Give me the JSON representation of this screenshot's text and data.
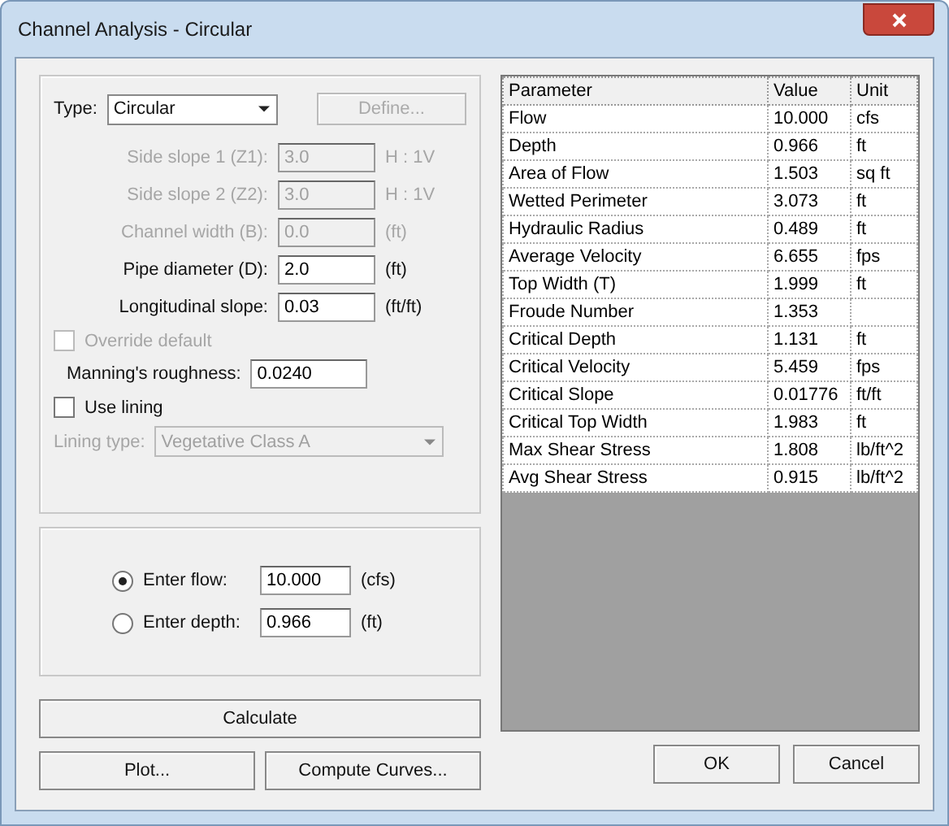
{
  "window": {
    "title": "Channel Analysis - Circular"
  },
  "type_select": {
    "label": "Type:",
    "value": "Circular",
    "disabled": false
  },
  "define_button": {
    "label": "Define...",
    "disabled": true
  },
  "fields": [
    {
      "label": "Side slope 1 (Z1):",
      "value": "3.0",
      "unit": "H : 1V",
      "disabled": true
    },
    {
      "label": "Side slope 2 (Z2):",
      "value": "3.0",
      "unit": "H : 1V",
      "disabled": true
    },
    {
      "label": "Channel width (B):",
      "value": "0.0",
      "unit": "(ft)",
      "disabled": true
    },
    {
      "label": "Pipe diameter (D):",
      "value": "2.0",
      "unit": "(ft)",
      "disabled": false
    },
    {
      "label": "Longitudinal slope:",
      "value": "0.03",
      "unit": "(ft/ft)",
      "disabled": false
    }
  ],
  "override_default": {
    "label": "Override default",
    "checked": false,
    "disabled": true
  },
  "mannings": {
    "label": "Manning's roughness:",
    "value": "0.0240"
  },
  "use_lining": {
    "label": "Use lining",
    "checked": false,
    "disabled": false
  },
  "lining_type": {
    "label": "Lining type:",
    "value": "Vegetative Class A",
    "disabled": true
  },
  "entry": [
    {
      "label": "Enter flow:",
      "value": "10.000",
      "unit": "(cfs)",
      "selected": true
    },
    {
      "label": "Enter depth:",
      "value": "0.966",
      "unit": "(ft)",
      "selected": false
    }
  ],
  "calculate_button": "Calculate",
  "bottom_buttons": [
    "Plot...",
    "Compute Curves..."
  ],
  "table": {
    "columns": [
      "Parameter",
      "Value",
      "Unit"
    ],
    "rows": [
      [
        "Flow",
        "10.000",
        "cfs"
      ],
      [
        "Depth",
        "0.966",
        "ft"
      ],
      [
        "Area of Flow",
        "1.503",
        "sq ft"
      ],
      [
        "Wetted Perimeter",
        "3.073",
        "ft"
      ],
      [
        "Hydraulic Radius",
        "0.489",
        "ft"
      ],
      [
        "Average Velocity",
        "6.655",
        "fps"
      ],
      [
        "Top Width (T)",
        "1.999",
        "ft"
      ],
      [
        "Froude Number",
        "1.353",
        ""
      ],
      [
        "Critical Depth",
        "1.131",
        "ft"
      ],
      [
        "Critical Velocity",
        "5.459",
        "fps"
      ],
      [
        "Critical Slope",
        "0.01776",
        "ft/ft"
      ],
      [
        "Critical Top Width",
        "1.983",
        "ft"
      ],
      [
        "Max Shear Stress",
        "1.808",
        "lb/ft^2"
      ],
      [
        "Avg Shear Stress",
        "0.915",
        "lb/ft^2"
      ]
    ]
  },
  "dialog_buttons": [
    "OK",
    "Cancel"
  ]
}
